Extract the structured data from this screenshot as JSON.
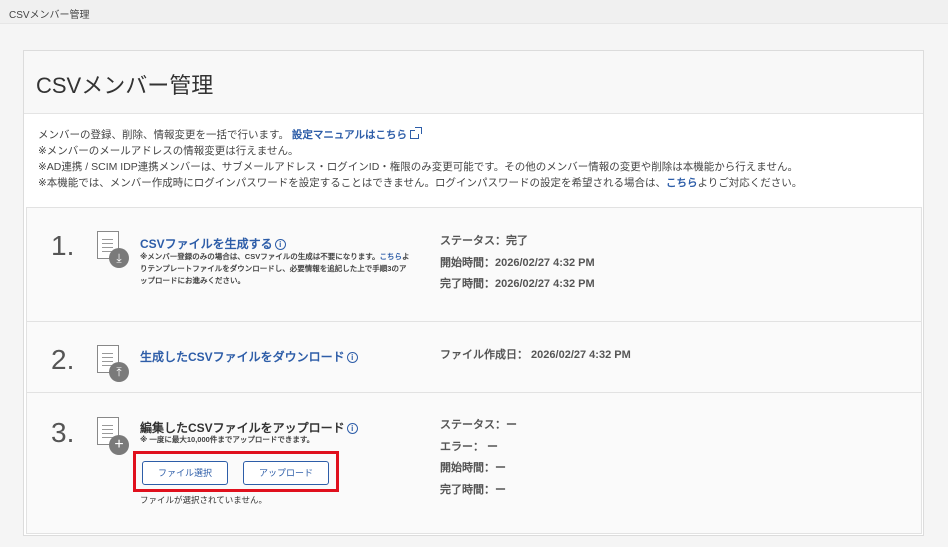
{
  "topbar": {
    "title": "CSVメンバー管理"
  },
  "panel": {
    "title": "CSVメンバー管理"
  },
  "notes": {
    "line1": "メンバーの登録、削除、情報変更を一括で行います。",
    "manual_link": "設定マニュアルはこちら",
    "line2": "※メンバーのメールアドレスの情報変更は行えません。",
    "line3": "※AD連携 / SCIM IDP連携メンバーは、サブメールアドレス・ログインID・権限のみ変更可能です。その他のメンバー情報の変更や削除は本機能から行えません。",
    "line4_pre": "※本機能では、メンバー作成時にログインパスワードを設定することはできません。ログインパスワードの設定を希望される場合は、",
    "line4_link": "こちら",
    "line4_post": "よりご対応ください。"
  },
  "steps": [
    {
      "number": "1.",
      "title": "CSVファイルを生成する",
      "info": "i",
      "desc_pre": "※メンバー登録のみの場合は、CSVファイルの生成は不要になります。",
      "desc_link": "こちら",
      "desc_post": "よりテンプレートファイルをダウンロードし、必要情報を追記した上で手順3のアップロードにお進みください。",
      "status": [
        "ステータス：完了",
        "開始時間：2026/02/27 4:32 PM",
        "完了時間：2026/02/27 4:32 PM"
      ]
    },
    {
      "number": "2.",
      "title": "生成したCSVファイルをダウンロード",
      "info": "i",
      "status": [
        "ファイル作成日： 2026/02/27 4:32 PM"
      ]
    },
    {
      "number": "3.",
      "title": "編集したCSVファイルをアップロード",
      "info": "i",
      "desc": "※ 一度に最大10,000件までアップロードできます。",
      "select_button": "ファイル選択",
      "upload_button": "アップロード",
      "file_note": "ファイルが選択されていません。",
      "status": [
        "ステータス：ー",
        "エラー： ー",
        "開始時間：ー",
        "完了時間：ー"
      ]
    }
  ],
  "icons": {
    "download": "download-icon",
    "upload": "upload-icon",
    "add": "plus-icon",
    "document": "document-icon",
    "external": "external-link-icon"
  },
  "colors": {
    "link": "#2d5da8",
    "highlight": "#e0101d"
  }
}
